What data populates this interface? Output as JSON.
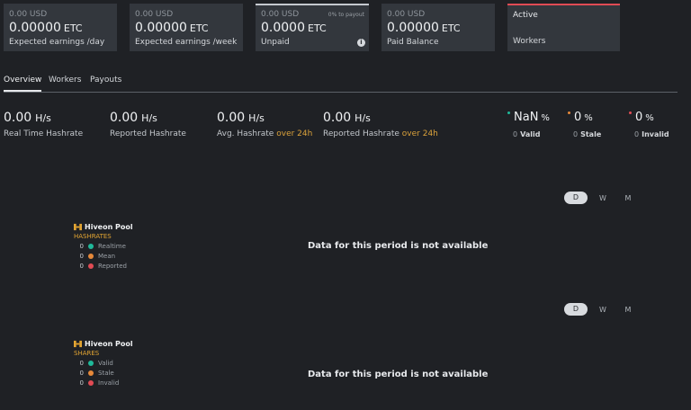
{
  "cards": [
    {
      "usd": "0.00 USD",
      "amount": "0.00000",
      "currency": "ETC",
      "label": "Expected earnings /day"
    },
    {
      "usd": "0.00 USD",
      "amount": "0.00000",
      "currency": "ETC",
      "label": "Expected earnings /week"
    },
    {
      "usd": "0.00 USD",
      "amount": "0.0000",
      "currency": "ETC",
      "label": "Unpaid",
      "note": "0% to payout",
      "info": "i"
    },
    {
      "usd": "0.00 USD",
      "amount": "0.00000",
      "currency": "ETC",
      "label": "Paid Balance"
    }
  ],
  "workers_card": {
    "active": "Active",
    "workers": "Workers",
    "accent": "#e14b54"
  },
  "tabs": [
    "Overview",
    "Workers",
    "Payouts"
  ],
  "stats": [
    {
      "value": "0.00",
      "unit": "H/s",
      "label": "Real Time Hashrate",
      "accent": ""
    },
    {
      "value": "0.00",
      "unit": "H/s",
      "label": "Reported Hashrate",
      "accent": ""
    },
    {
      "value": "0.00",
      "unit": "H/s",
      "label": "Avg. Hashrate",
      "accent": "over 24h"
    },
    {
      "value": "0.00",
      "unit": "H/s",
      "label": "Reported Hashrate",
      "accent": "over 24h"
    }
  ],
  "shares": [
    {
      "value": "NaN",
      "pct": "%",
      "count": "0",
      "label": "Valid",
      "color": "#1fb99a"
    },
    {
      "value": "0",
      "pct": "%",
      "count": "0",
      "label": "Stale",
      "color": "#e6893a"
    },
    {
      "value": "0",
      "pct": "%",
      "count": "0",
      "label": "Invalid",
      "color": "#e14b54"
    }
  ],
  "periods": [
    "D",
    "W",
    "M"
  ],
  "hashrate_chart": {
    "brand": "Hiveon Pool",
    "section": "HASHRATES",
    "rows": [
      {
        "n": "0",
        "label": "Realtime",
        "color": "#1fb99a"
      },
      {
        "n": "0",
        "label": "Mean",
        "color": "#e6893a"
      },
      {
        "n": "0",
        "label": "Reported",
        "color": "#e14b54"
      }
    ],
    "message": "Data for this period is not available"
  },
  "shares_chart": {
    "brand": "Hiveon Pool",
    "section": "SHARES",
    "rows": [
      {
        "n": "0",
        "label": "Valid",
        "color": "#1fb99a"
      },
      {
        "n": "0",
        "label": "Stale",
        "color": "#e6893a"
      },
      {
        "n": "0",
        "label": "Invalid",
        "color": "#e14b54"
      }
    ],
    "message": "Data for this period is not available"
  }
}
